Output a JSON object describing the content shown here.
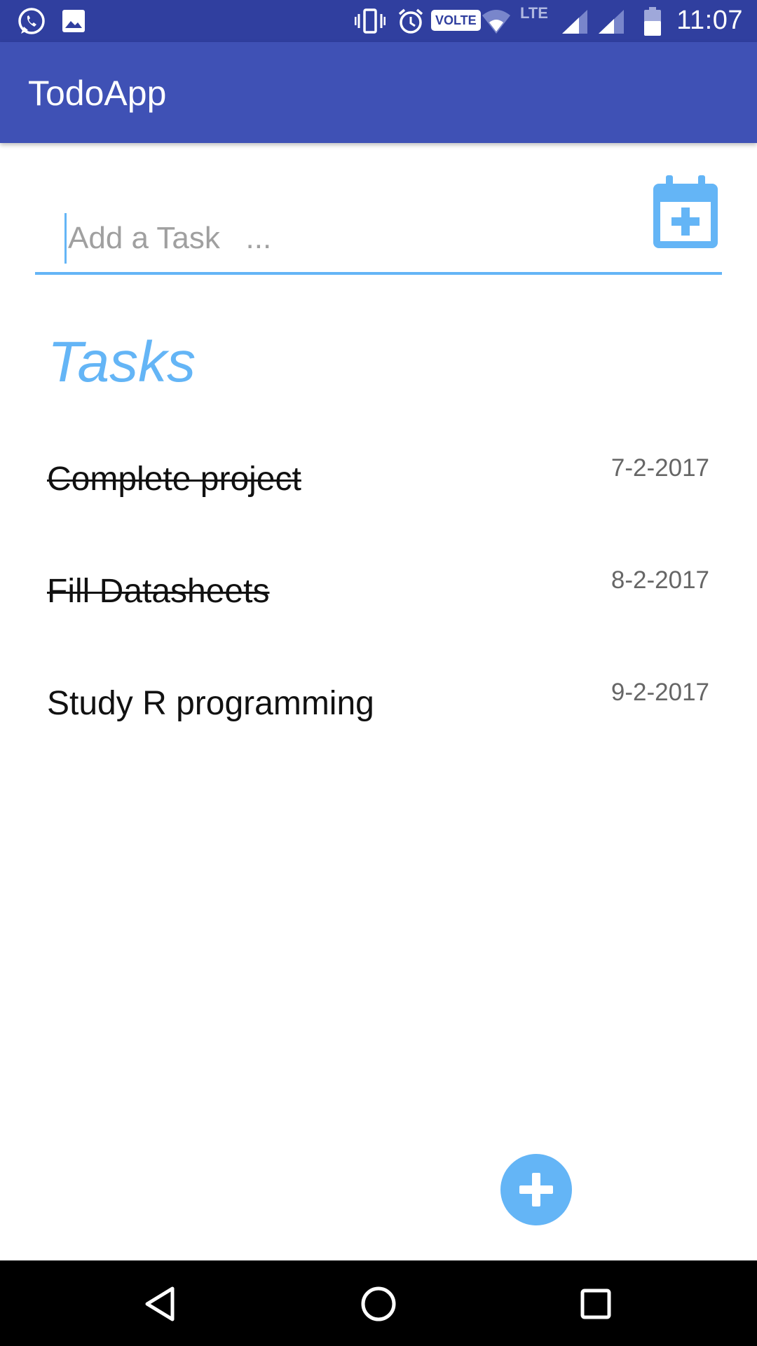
{
  "status_bar": {
    "time": "11:07",
    "volte": "VOLTE",
    "lte": "LTE",
    "icons": [
      "whatsapp-icon",
      "image-icon",
      "vibrate-icon",
      "alarm-icon",
      "volte-icon",
      "wifi-icon",
      "lte-icon",
      "signal-icon",
      "signal-icon-2",
      "battery-icon"
    ]
  },
  "app_bar": {
    "title": "TodoApp"
  },
  "input": {
    "placeholder": "Add a Task   ...",
    "value": ""
  },
  "tasks_heading": "Tasks",
  "tasks": [
    {
      "name": "Complete project",
      "date": "7-2-2017",
      "done": true
    },
    {
      "name": "Fill Datasheets",
      "date": "8-2-2017",
      "done": true
    },
    {
      "name": "Study R programming",
      "date": "9-2-2017",
      "done": false
    }
  ],
  "colors": {
    "status_bar": "#303F9F",
    "app_bar": "#3F51B5",
    "accent": "#64B5F6"
  },
  "nav": {
    "icons": [
      "back-icon",
      "home-icon",
      "recents-icon"
    ]
  }
}
